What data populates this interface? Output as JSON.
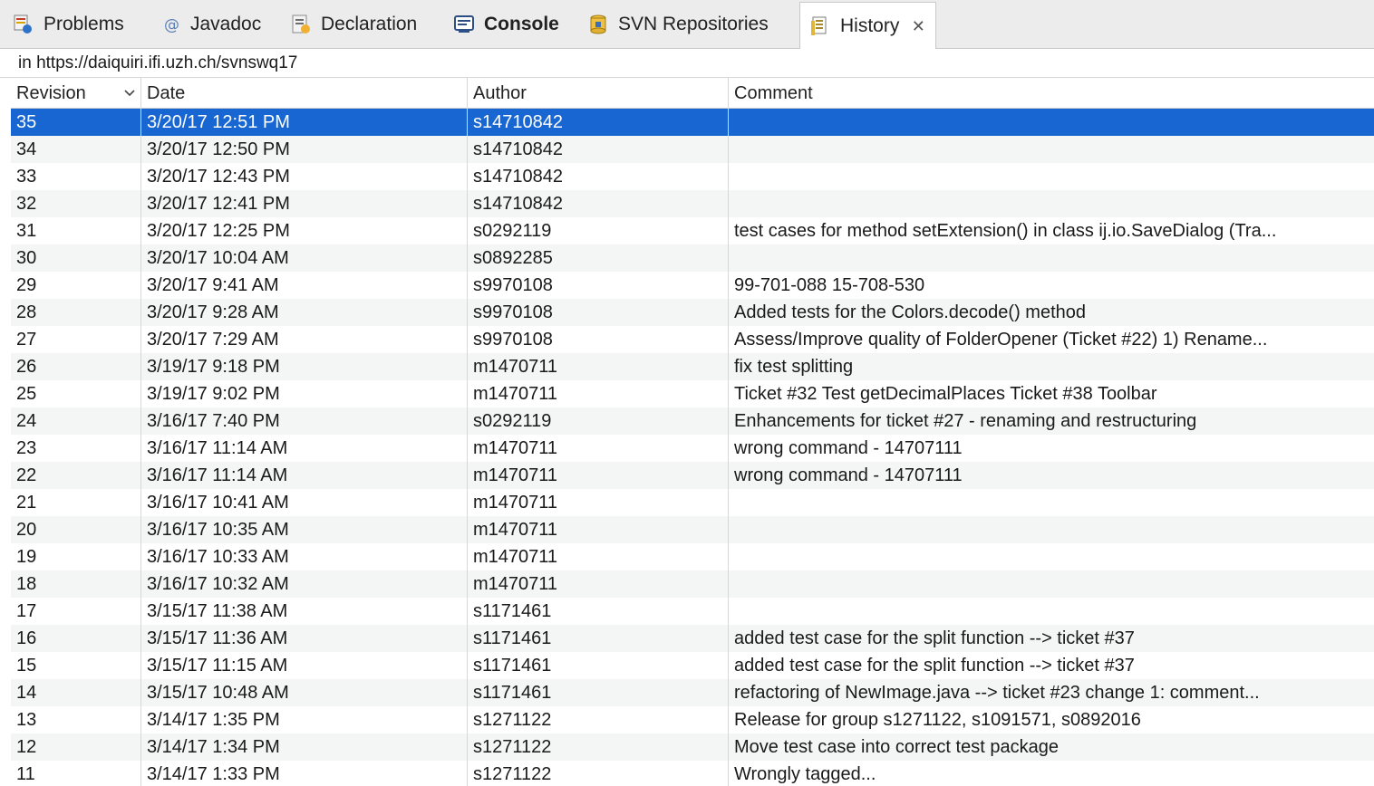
{
  "tabs": [
    {
      "label": "Problems",
      "icon": "problems-icon"
    },
    {
      "label": "Javadoc",
      "icon": "javadoc-icon"
    },
    {
      "label": "Declaration",
      "icon": "declaration-icon"
    },
    {
      "label": "Console",
      "icon": "console-icon"
    },
    {
      "label": "SVN Repositories",
      "icon": "svn-repositories-icon"
    },
    {
      "label": "History",
      "icon": "history-icon",
      "close": "✕"
    }
  ],
  "location": "in https://daiquiri.ifi.uzh.ch/svnswq17",
  "columns": {
    "revision": "Revision",
    "date": "Date",
    "author": "Author",
    "comment": "Comment"
  },
  "colors": {
    "selection": "#1766d1",
    "alt_row": "#f4f5f5"
  },
  "rows": [
    {
      "rev": "35",
      "date": "3/20/17 12:51 PM",
      "author": "s14710842",
      "comment": ""
    },
    {
      "rev": "34",
      "date": "3/20/17 12:50 PM",
      "author": "s14710842",
      "comment": ""
    },
    {
      "rev": "33",
      "date": "3/20/17 12:43 PM",
      "author": "s14710842",
      "comment": ""
    },
    {
      "rev": "32",
      "date": "3/20/17 12:41 PM",
      "author": "s14710842",
      "comment": ""
    },
    {
      "rev": "31",
      "date": "3/20/17 12:25 PM",
      "author": "s0292119",
      "comment": "test cases for method setExtension() in class ij.io.SaveDialog (Tra..."
    },
    {
      "rev": "30",
      "date": "3/20/17 10:04 AM",
      "author": "s0892285",
      "comment": ""
    },
    {
      "rev": "29",
      "date": "3/20/17 9:41 AM",
      "author": "s9970108",
      "comment": "99-701-088 15-708-530"
    },
    {
      "rev": "28",
      "date": "3/20/17 9:28 AM",
      "author": "s9970108",
      "comment": "Added  tests for the Colors.decode() method"
    },
    {
      "rev": "27",
      "date": "3/20/17 7:29 AM",
      "author": "s9970108",
      "comment": "Assess/Improve quality of FolderOpener (Ticket #22)  1) Rename..."
    },
    {
      "rev": "26",
      "date": "3/19/17 9:18 PM",
      "author": "m1470711",
      "comment": "fix test splitting"
    },
    {
      "rev": "25",
      "date": "3/19/17 9:02 PM",
      "author": "m1470711",
      "comment": "Ticket #32 Test getDecimalPlaces Ticket #38 Toolbar"
    },
    {
      "rev": "24",
      "date": "3/16/17 7:40 PM",
      "author": "s0292119",
      "comment": "Enhancements for ticket #27 - renaming and restructuring"
    },
    {
      "rev": "23",
      "date": "3/16/17 11:14 AM",
      "author": "m1470711",
      "comment": "wrong command - 14707111"
    },
    {
      "rev": "22",
      "date": "3/16/17 11:14 AM",
      "author": "m1470711",
      "comment": "wrong command - 14707111"
    },
    {
      "rev": "21",
      "date": "3/16/17 10:41 AM",
      "author": "m1470711",
      "comment": ""
    },
    {
      "rev": "20",
      "date": "3/16/17 10:35 AM",
      "author": "m1470711",
      "comment": ""
    },
    {
      "rev": "19",
      "date": "3/16/17 10:33 AM",
      "author": "m1470711",
      "comment": ""
    },
    {
      "rev": "18",
      "date": "3/16/17 10:32 AM",
      "author": "m1470711",
      "comment": ""
    },
    {
      "rev": "17",
      "date": "3/15/17 11:38 AM",
      "author": "s1171461",
      "comment": ""
    },
    {
      "rev": "16",
      "date": "3/15/17 11:36 AM",
      "author": "s1171461",
      "comment": "added test case for the split function --> ticket #37"
    },
    {
      "rev": "15",
      "date": "3/15/17 11:15 AM",
      "author": "s1171461",
      "comment": "added test case for the split function --> ticket #37"
    },
    {
      "rev": "14",
      "date": "3/15/17 10:48 AM",
      "author": "s1171461",
      "comment": "refactoring of NewImage.java --> ticket #23 change 1: comment..."
    },
    {
      "rev": "13",
      "date": "3/14/17 1:35 PM",
      "author": "s1271122",
      "comment": "Release for group s1271122, s1091571, s0892016"
    },
    {
      "rev": "12",
      "date": "3/14/17 1:34 PM",
      "author": "s1271122",
      "comment": "Move test case into correct test package"
    },
    {
      "rev": "11",
      "date": "3/14/17 1:33 PM",
      "author": "s1271122",
      "comment": "Wrongly tagged..."
    }
  ]
}
